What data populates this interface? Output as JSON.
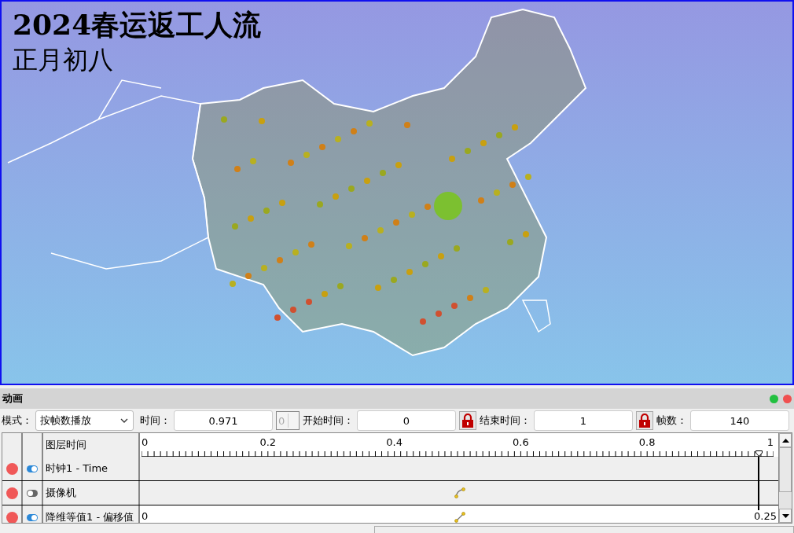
{
  "viewport": {
    "title": "2024春运返工人流",
    "subtitle": "正月初八"
  },
  "panel": {
    "title": "动画",
    "toolbar": {
      "mode_label": "模式：",
      "mode_value": "按帧数播放",
      "time_label": "时间：",
      "time_value": "0.971",
      "spin_value": "0",
      "start_label": "开始时间：",
      "start_value": "0",
      "start_locked": true,
      "end_label": "结束时间：",
      "end_value": "1",
      "end_locked": true,
      "frames_label": "帧数：",
      "frames_value": "140"
    },
    "timeline": {
      "header": "图层时间",
      "ticks": [
        "0",
        "0.2",
        "0.4",
        "0.6",
        "0.8",
        "1"
      ],
      "playhead": {
        "level": 0.971
      },
      "rows": [
        {
          "name": "时钟1 - Time",
          "visible": true,
          "selected": false
        },
        {
          "name": "摄像机",
          "visible": false,
          "selected": false,
          "keyframe": {
            "kind": "curve"
          }
        },
        {
          "name": "降维等值1 - 偏移值",
          "visible": true,
          "selected": true,
          "keyframe": {
            "kind": "linear"
          },
          "start_value": "0",
          "end_value": "0.25"
        }
      ]
    }
  }
}
